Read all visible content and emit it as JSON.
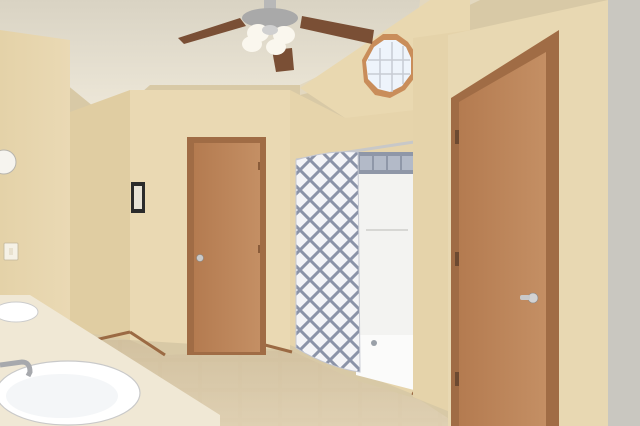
{
  "scene": {
    "kind": "photo",
    "colors": {
      "wall": "#e6d5ae",
      "wall_shadow": "#d3c196",
      "ceiling": "#e9e3d4",
      "door": "#b9845a",
      "door_frame": "#a06c45",
      "floor": "#d8c7a8",
      "curtain_base": "#f2f2f5",
      "curtain_pattern": "#8a93a8",
      "counter": "#f1ead8",
      "sink": "#ffffff",
      "right_wall": "#c9c7c0"
    }
  }
}
